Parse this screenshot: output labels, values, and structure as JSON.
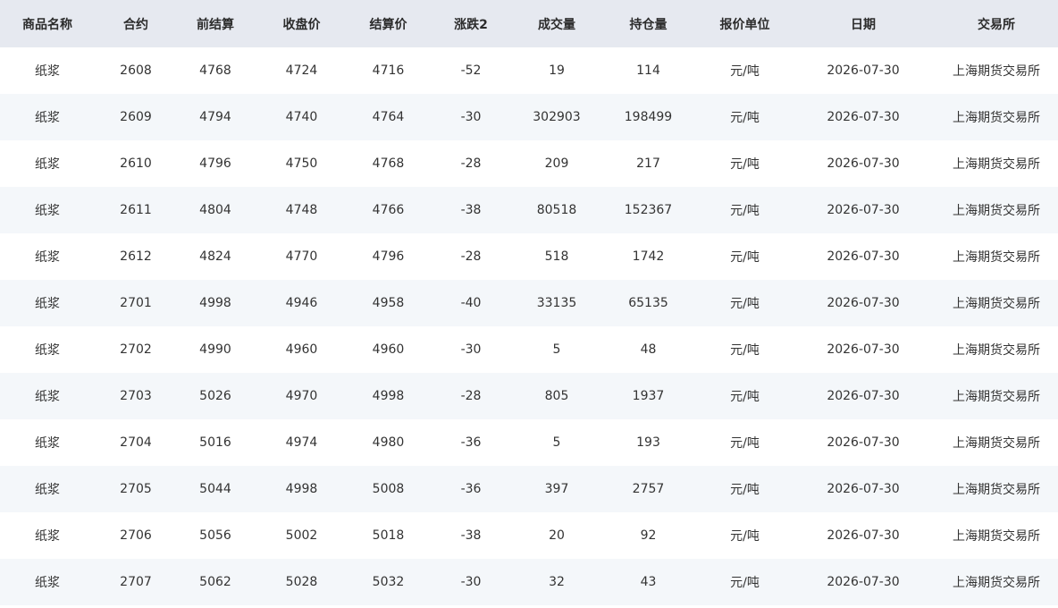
{
  "table": {
    "headers": [
      "商品名称",
      "合约",
      "前结算",
      "收盘价",
      "结算价",
      "涨跌2",
      "成交量",
      "持仓量",
      "报价单位",
      "日期",
      "交易所"
    ],
    "rows": [
      {
        "name": "纸浆",
        "contract": "2608",
        "prev_settle": "4768",
        "close": "4724",
        "settle": "4716",
        "change": "-52",
        "volume": "19",
        "open_interest": "114",
        "unit": "元/吨",
        "date": "2026-07-30",
        "exchange": "上海期货交易所"
      },
      {
        "name": "纸浆",
        "contract": "2609",
        "prev_settle": "4794",
        "close": "4740",
        "settle": "4764",
        "change": "-30",
        "volume": "302903",
        "open_interest": "198499",
        "unit": "元/吨",
        "date": "2026-07-30",
        "exchange": "上海期货交易所"
      },
      {
        "name": "纸浆",
        "contract": "2610",
        "prev_settle": "4796",
        "close": "4750",
        "settle": "4768",
        "change": "-28",
        "volume": "209",
        "open_interest": "217",
        "unit": "元/吨",
        "date": "2026-07-30",
        "exchange": "上海期货交易所"
      },
      {
        "name": "纸浆",
        "contract": "2611",
        "prev_settle": "4804",
        "close": "4748",
        "settle": "4766",
        "change": "-38",
        "volume": "80518",
        "open_interest": "152367",
        "unit": "元/吨",
        "date": "2026-07-30",
        "exchange": "上海期货交易所"
      },
      {
        "name": "纸浆",
        "contract": "2612",
        "prev_settle": "4824",
        "close": "4770",
        "settle": "4796",
        "change": "-28",
        "volume": "518",
        "open_interest": "1742",
        "unit": "元/吨",
        "date": "2026-07-30",
        "exchange": "上海期货交易所"
      },
      {
        "name": "纸浆",
        "contract": "2701",
        "prev_settle": "4998",
        "close": "4946",
        "settle": "4958",
        "change": "-40",
        "volume": "33135",
        "open_interest": "65135",
        "unit": "元/吨",
        "date": "2026-07-30",
        "exchange": "上海期货交易所"
      },
      {
        "name": "纸浆",
        "contract": "2702",
        "prev_settle": "4990",
        "close": "4960",
        "settle": "4960",
        "change": "-30",
        "volume": "5",
        "open_interest": "48",
        "unit": "元/吨",
        "date": "2026-07-30",
        "exchange": "上海期货交易所"
      },
      {
        "name": "纸浆",
        "contract": "2703",
        "prev_settle": "5026",
        "close": "4970",
        "settle": "4998",
        "change": "-28",
        "volume": "805",
        "open_interest": "1937",
        "unit": "元/吨",
        "date": "2026-07-30",
        "exchange": "上海期货交易所"
      },
      {
        "name": "纸浆",
        "contract": "2704",
        "prev_settle": "5016",
        "close": "4974",
        "settle": "4980",
        "change": "-36",
        "volume": "5",
        "open_interest": "193",
        "unit": "元/吨",
        "date": "2026-07-30",
        "exchange": "上海期货交易所"
      },
      {
        "name": "纸浆",
        "contract": "2705",
        "prev_settle": "5044",
        "close": "4998",
        "settle": "5008",
        "change": "-36",
        "volume": "397",
        "open_interest": "2757",
        "unit": "元/吨",
        "date": "2026-07-30",
        "exchange": "上海期货交易所"
      },
      {
        "name": "纸浆",
        "contract": "2706",
        "prev_settle": "5056",
        "close": "5002",
        "settle": "5018",
        "change": "-38",
        "volume": "20",
        "open_interest": "92",
        "unit": "元/吨",
        "date": "2026-07-30",
        "exchange": "上海期货交易所"
      },
      {
        "name": "纸浆",
        "contract": "2707",
        "prev_settle": "5062",
        "close": "5028",
        "settle": "5032",
        "change": "-30",
        "volume": "32",
        "open_interest": "43",
        "unit": "元/吨",
        "date": "2026-07-30",
        "exchange": "上海期货交易所"
      }
    ]
  },
  "colors": {
    "header_bg": "#e6e9f0",
    "row_alt_bg": "#f4f7fa",
    "change_down": "#17a06f"
  }
}
